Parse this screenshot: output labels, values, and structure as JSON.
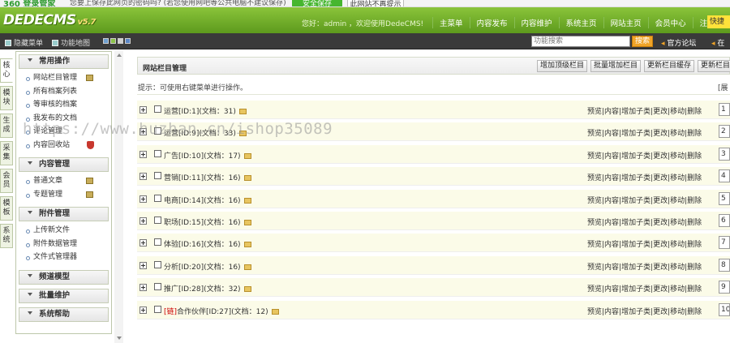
{
  "strip360": {
    "logo": "360 登录管家",
    "message": "您要上保存此网页的密码吗?  (若您使用网吧等公共电脑不建议保存)",
    "save_button": "安全保存",
    "no_prompt_button": "此网站不再提示"
  },
  "header": {
    "brand": "DEDECMS",
    "version": "v5.7",
    "greeting": "您好：admin ，欢迎使用DedeCMS!",
    "nav": [
      "主菜单",
      "内容发布",
      "内容维护",
      "系统主页",
      "网站主页",
      "会员中心",
      "注销"
    ],
    "quick": "快捷"
  },
  "toolbar": {
    "hide_menu": "隐藏菜单",
    "func_map": "功能地图",
    "swatch_colors": [
      "#6fa0d0",
      "#8bc34a",
      "#cfcfcf",
      "#5b86c5"
    ],
    "search_placeholder": "功能搜索",
    "search_button": "搜索",
    "forum": "官方论坛",
    "other": "在"
  },
  "vtabs": [
    "核心",
    "模块",
    "生成",
    "采集",
    "会员",
    "模板",
    "系统"
  ],
  "sidebar": {
    "sections": [
      {
        "title": "常用操作",
        "items": [
          {
            "label": "网站栏目管理",
            "icon": "add"
          },
          {
            "label": "所有档案列表",
            "icon": ""
          },
          {
            "label": "等审核的档案",
            "icon": ""
          },
          {
            "label": "我发布的文档",
            "icon": ""
          },
          {
            "label": "评论管理",
            "icon": ""
          },
          {
            "label": "内容回收站",
            "icon": "del"
          }
        ]
      },
      {
        "title": "内容管理",
        "items": [
          {
            "label": "普通文章",
            "icon": "add"
          },
          {
            "label": "专题管理",
            "icon": "add"
          }
        ]
      },
      {
        "title": "附件管理",
        "items": [
          {
            "label": "上传新文件",
            "icon": ""
          },
          {
            "label": "附件数据管理",
            "icon": ""
          },
          {
            "label": "文件式管理器",
            "icon": ""
          }
        ]
      },
      {
        "title": "频道模型",
        "items": []
      },
      {
        "title": "批量维护",
        "items": []
      },
      {
        "title": "系统帮助",
        "items": []
      }
    ]
  },
  "main": {
    "title": "网站栏目管理",
    "buttons": [
      "增加顶级栏目",
      "批量增加栏目",
      "更新栏目缓存",
      "更新栏目"
    ],
    "tip": "提示：可使用右键菜单进行操作。",
    "tip_right": "[展",
    "rows": [
      {
        "prefix": "",
        "name": "运营[ID:1](文档：31)",
        "order": "1"
      },
      {
        "prefix": "",
        "name": "运营[ID:9](文档：33)",
        "order": "2"
      },
      {
        "prefix": "",
        "name": "广告[ID:10](文档：17)",
        "order": "3"
      },
      {
        "prefix": "",
        "name": "营销[ID:11](文档：16)",
        "order": "4"
      },
      {
        "prefix": "",
        "name": "电商[ID:14](文档：16)",
        "order": "5"
      },
      {
        "prefix": "",
        "name": "职场[ID:15](文档：16)",
        "order": "6"
      },
      {
        "prefix": "",
        "name": "体验[ID:16](文档：16)",
        "order": "7"
      },
      {
        "prefix": "",
        "name": "分析[ID:20](文档：16)",
        "order": "8"
      },
      {
        "prefix": "",
        "name": "推广[ID:28](文档：32)",
        "order": "9"
      },
      {
        "prefix": "[链]",
        "name": "合作伙伴[ID:27](文档：12)",
        "order": "10"
      }
    ],
    "row_actions": "预览|内容|增加子类|更改|移动|删除"
  },
  "watermark": "https://www.huzhan.cn/ishop35089"
}
